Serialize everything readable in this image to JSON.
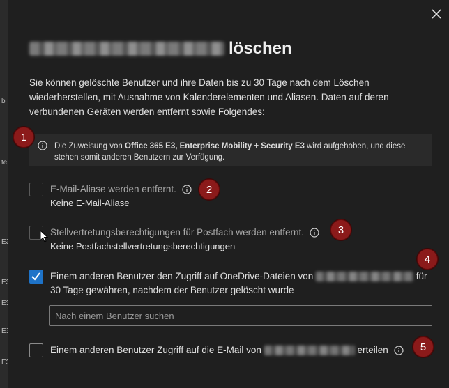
{
  "left_strip": {
    "labels": [
      "b",
      "ter",
      "E3",
      "E3",
      "E3",
      "E3",
      "E3"
    ]
  },
  "dialog": {
    "title_suffix": "löschen",
    "intro": "Sie können gelöschte Benutzer und ihre Daten bis zu 30 Tage nach dem Löschen wiederherstellen, mit Ausnahme von Kalenderelementen und Aliasen. Daten auf deren verbundenen Geräten werden entfernt sowie Folgendes:",
    "info": {
      "prefix": "Die Zuweisung von ",
      "licenses": "Office 365 E3, Enterprise Mobility + Security E3",
      "suffix": " wird aufgehoben, und diese stehen somit anderen Benutzern zur Verfügung."
    },
    "options": [
      {
        "label": "E-Mail-Aliase werden entfernt.",
        "sub": "Keine E-Mail-Aliase",
        "checked": false
      },
      {
        "label": "Stellvertretungsberechtigungen für Postfach werden entfernt.",
        "sub": "Keine Postfachstellvertretungsberechtigungen",
        "checked": false
      },
      {
        "label_a": "Einem anderen Benutzer den Zugriff auf OneDrive-Dateien von",
        "label_b": "für",
        "label_c": "30 Tage gewähren, nachdem der Benutzer gelöscht wurde",
        "checked": true
      },
      {
        "label_a": "Einem anderen Benutzer Zugriff auf die E-Mail von",
        "label_b": "erteilen",
        "checked": false
      }
    ],
    "search_placeholder": "Nach einem Benutzer suchen",
    "markers": [
      "1",
      "2",
      "3",
      "4",
      "5"
    ]
  },
  "colors": {
    "accent": "#1e73c8",
    "marker": "#8b1a1a",
    "background": "#1f1f1f"
  }
}
